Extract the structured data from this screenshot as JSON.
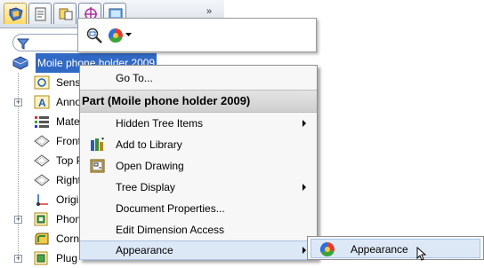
{
  "tree": {
    "root_label": "Moile phone holder 2009",
    "items": [
      {
        "label": "Sensors",
        "icon": "sensor-icon",
        "expandable": false
      },
      {
        "label": "Annotations",
        "icon": "annotations-icon",
        "expandable": true
      },
      {
        "label": "Material",
        "icon": "material-icon",
        "expandable": false
      },
      {
        "label": "Front Plane",
        "icon": "plane-icon",
        "expandable": false
      },
      {
        "label": "Top Plane",
        "icon": "plane-icon",
        "expandable": false
      },
      {
        "label": "Right Plane",
        "icon": "plane-icon",
        "expandable": false
      },
      {
        "label": "Origin",
        "icon": "origin-icon",
        "expandable": false
      },
      {
        "label": "Phone",
        "icon": "feature-icon",
        "expandable": true
      },
      {
        "label": "Corner",
        "icon": "feature-icon",
        "expandable": false
      },
      {
        "label": "Plug",
        "icon": "feature-icon",
        "expandable": true
      }
    ]
  },
  "context_menu": {
    "goto": "Go To...",
    "header": "Part (Moile phone holder 2009)",
    "hidden_tree_items": "Hidden Tree Items",
    "add_to_library": "Add to Library",
    "open_drawing": "Open Drawing",
    "tree_display": "Tree Display",
    "document_properties": "Document Properties...",
    "edit_dimension_access": "Edit Dimension Access",
    "appearance": "Appearance"
  },
  "submenu": {
    "appearance": "Appearance"
  },
  "tabs": [
    "featuremanager-tab",
    "propertymanager-tab",
    "configurationmanager-tab",
    "dimxpert-tab",
    "display-tab"
  ],
  "tab_more": "»",
  "colors": {
    "selection": "#316ac5",
    "menu_hover": "#dde8f7",
    "accent_blue": "#1f5fbf"
  }
}
